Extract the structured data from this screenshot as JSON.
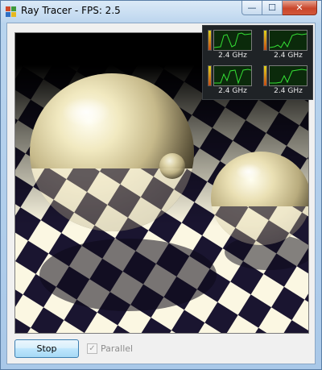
{
  "window": {
    "title": "Ray Tracer - FPS: 2.5",
    "minimize_glyph": "—",
    "maximize_glyph": "☐",
    "close_glyph": "✕"
  },
  "controls": {
    "stop_label": "Stop",
    "parallel_label": "Parallel",
    "parallel_checked": true,
    "parallel_enabled": false,
    "check_glyph": "✓"
  },
  "cpu_meter": {
    "cores": [
      {
        "label": "2.4 GHz",
        "load": 0.9
      },
      {
        "label": "2.4 GHz",
        "load": 0.9
      },
      {
        "label": "2.4 GHz",
        "load": 0.85
      },
      {
        "label": "2.4 GHz",
        "load": 0.88
      }
    ]
  },
  "scene": {
    "checker_dark": "#1a1530",
    "checker_light": "#fbf7e2",
    "sphere_color": "#ece3b4"
  }
}
